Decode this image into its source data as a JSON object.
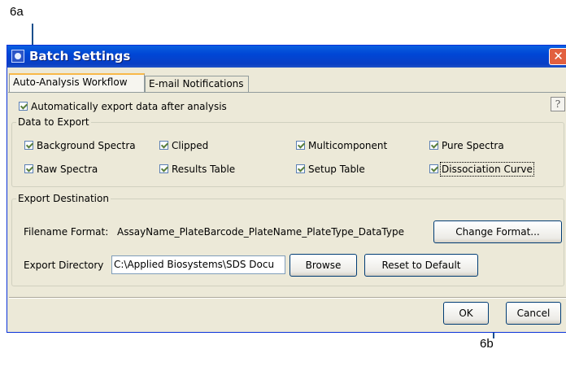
{
  "callouts": {
    "top": "6a",
    "bottom": "6b"
  },
  "window": {
    "title": "Batch Settings",
    "close_glyph": "✕"
  },
  "tabs": [
    {
      "label": "Auto-Analysis Workflow",
      "active": true
    },
    {
      "label": "E-mail Notifications",
      "active": false
    }
  ],
  "auto_export": {
    "label": "Automatically export data after analysis",
    "checked": true
  },
  "help_button": {
    "label": "?"
  },
  "data_to_export": {
    "legend": "Data to Export",
    "items": [
      {
        "label": "Background Spectra",
        "checked": true
      },
      {
        "label": "Clipped",
        "checked": true
      },
      {
        "label": "Multicomponent",
        "checked": true
      },
      {
        "label": "Pure Spectra",
        "checked": true
      },
      {
        "label": "Raw Spectra",
        "checked": true
      },
      {
        "label": "Results Table",
        "checked": true
      },
      {
        "label": "Setup Table",
        "checked": true
      },
      {
        "label": "Dissociation Curve",
        "checked": true
      }
    ]
  },
  "export_destination": {
    "legend": "Export Destination",
    "filename_format_label": "Filename Format:",
    "filename_format_value": "AssayName_PlateBarcode_PlateName_PlateType_DataType",
    "change_format_button": "Change Format...",
    "export_directory_label": "Export Directory",
    "export_directory_value": "C:\\Applied Biosystems\\SDS Docu",
    "browse_button": "Browse",
    "reset_button": "Reset to Default"
  },
  "footer": {
    "ok_button": "OK",
    "cancel_button": "Cancel"
  }
}
